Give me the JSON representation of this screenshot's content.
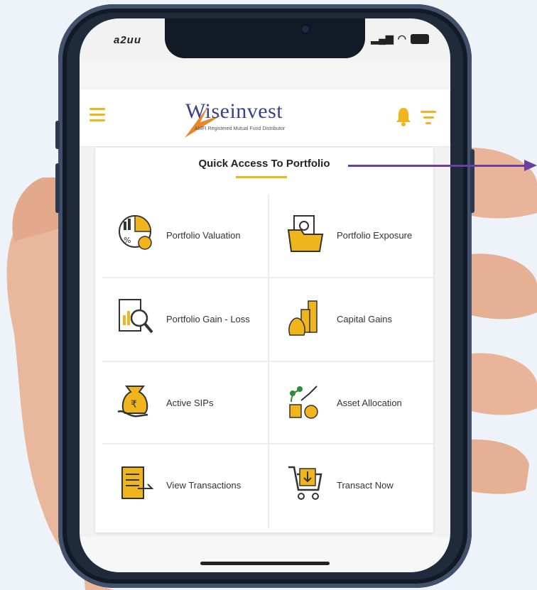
{
  "status": {
    "time": "a2uu"
  },
  "app": {
    "logo_text": "Wiseinvest",
    "logo_tagline": "AMFI Registered Mutual Fund Distributor"
  },
  "card": {
    "title": "Quick Access To Portfolio",
    "items": [
      {
        "label": "Portfolio Valuation",
        "icon": "portfolio-valuation-icon"
      },
      {
        "label": "Portfolio Exposure",
        "icon": "portfolio-exposure-icon"
      },
      {
        "label": "Portfolio Gain - Loss",
        "icon": "gain-loss-icon"
      },
      {
        "label": "Capital Gains",
        "icon": "capital-gains-icon"
      },
      {
        "label": "Active SIPs",
        "icon": "active-sips-icon"
      },
      {
        "label": "Asset Allocation",
        "icon": "asset-allocation-icon"
      },
      {
        "label": "View Transactions",
        "icon": "view-transactions-icon"
      },
      {
        "label": "Transact Now",
        "icon": "transact-now-icon"
      }
    ]
  },
  "colors": {
    "accent": "#f0b51c",
    "brand": "#3a3f8f",
    "arrow": "#6b3fa0"
  }
}
